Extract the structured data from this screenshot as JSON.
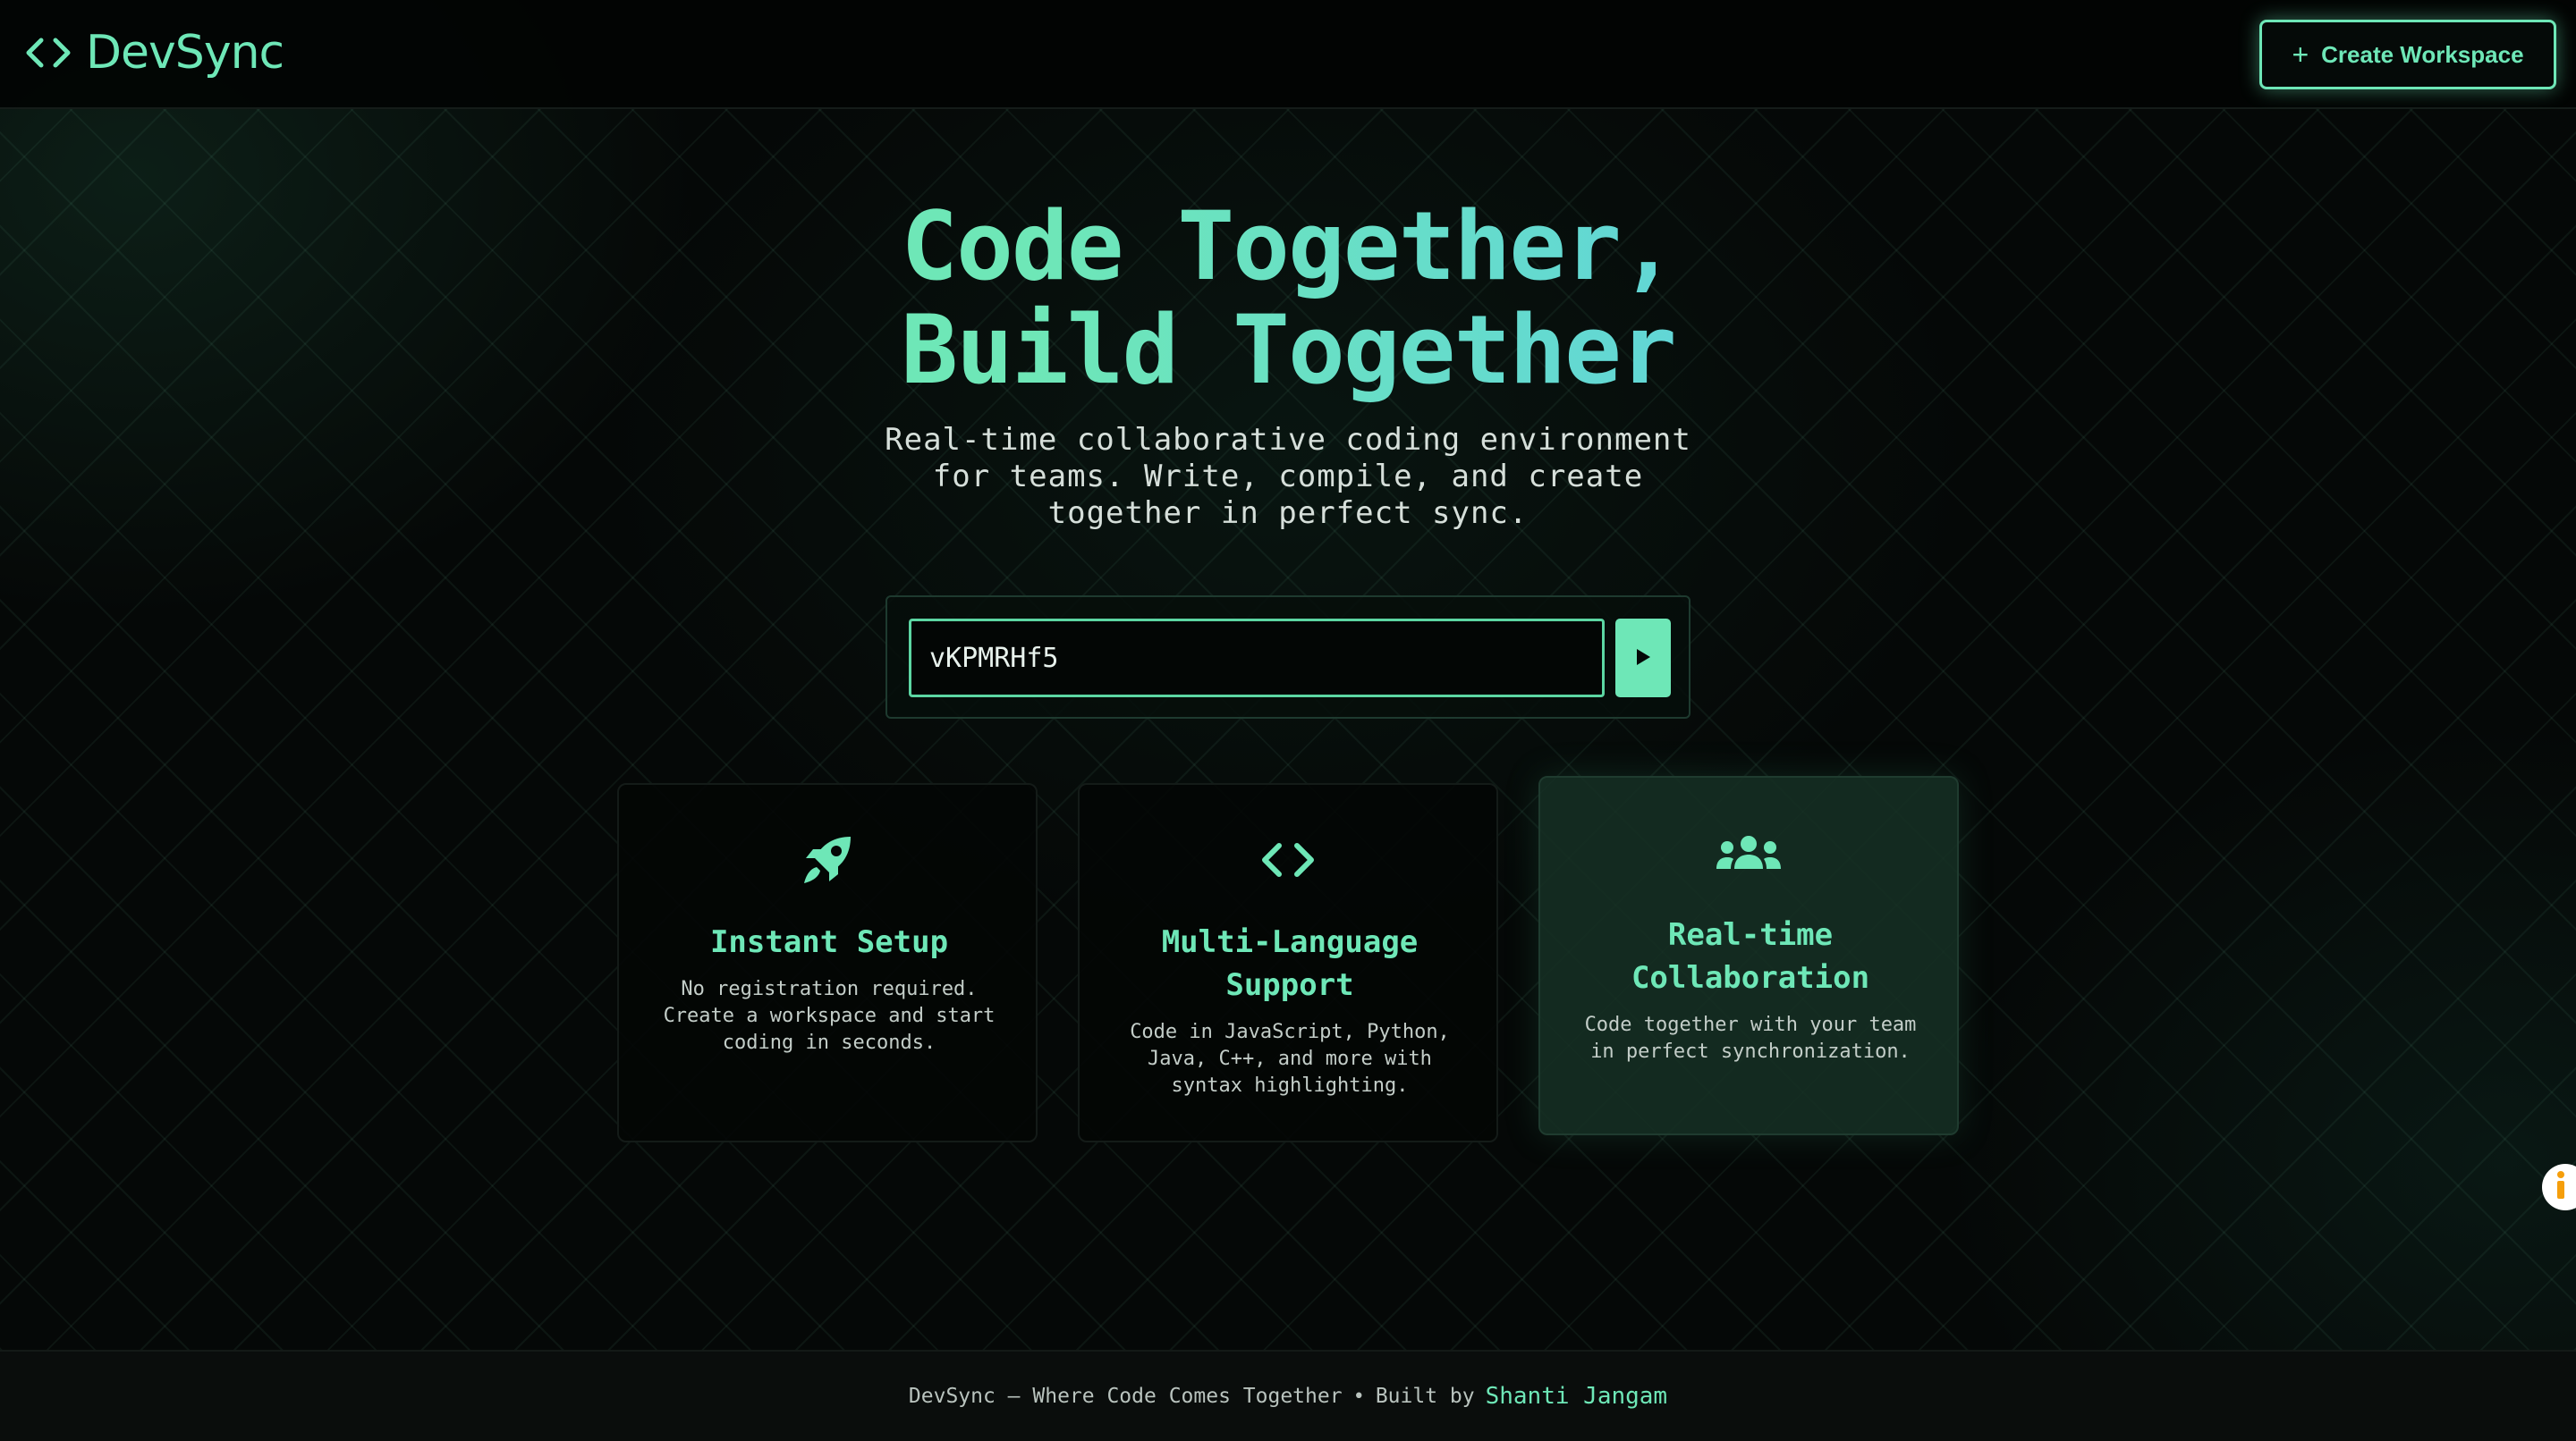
{
  "header": {
    "logo_text": "DevSync",
    "logo_icon": "code-brackets-icon",
    "create_button_label": "Create Workspace",
    "create_button_icon": "plus"
  },
  "hero": {
    "title_line1": "Code Together,",
    "title_line2": "Build Together",
    "subtitle": "Real-time collaborative coding environment for teams. Write, compile, and create together in perfect sync."
  },
  "join": {
    "room_id_value": "vKPMRHf5",
    "submit_icon": "play-icon"
  },
  "features": [
    {
      "icon": "rocket-icon",
      "title": "Instant Setup",
      "description": "No registration required. Create a workspace and start coding in seconds."
    },
    {
      "icon": "code-brackets-icon",
      "title": "Multi-Language Support",
      "description": "Code in JavaScript, Python, Java, C++, and more with syntax highlighting."
    },
    {
      "icon": "users-icon",
      "title": "Real-time Collaboration",
      "description": "Code together with your team in perfect synchronization."
    }
  ],
  "footer": {
    "tagline": "DevSync – Where Code Comes Together",
    "separator": "•",
    "built_by": "Built by",
    "author": "Shanti Jangam"
  },
  "colors": {
    "accent": "#6ee7b7",
    "accent_cyan": "#5fd3dc",
    "background": "#050807",
    "help_icon": "#f59e0b"
  }
}
